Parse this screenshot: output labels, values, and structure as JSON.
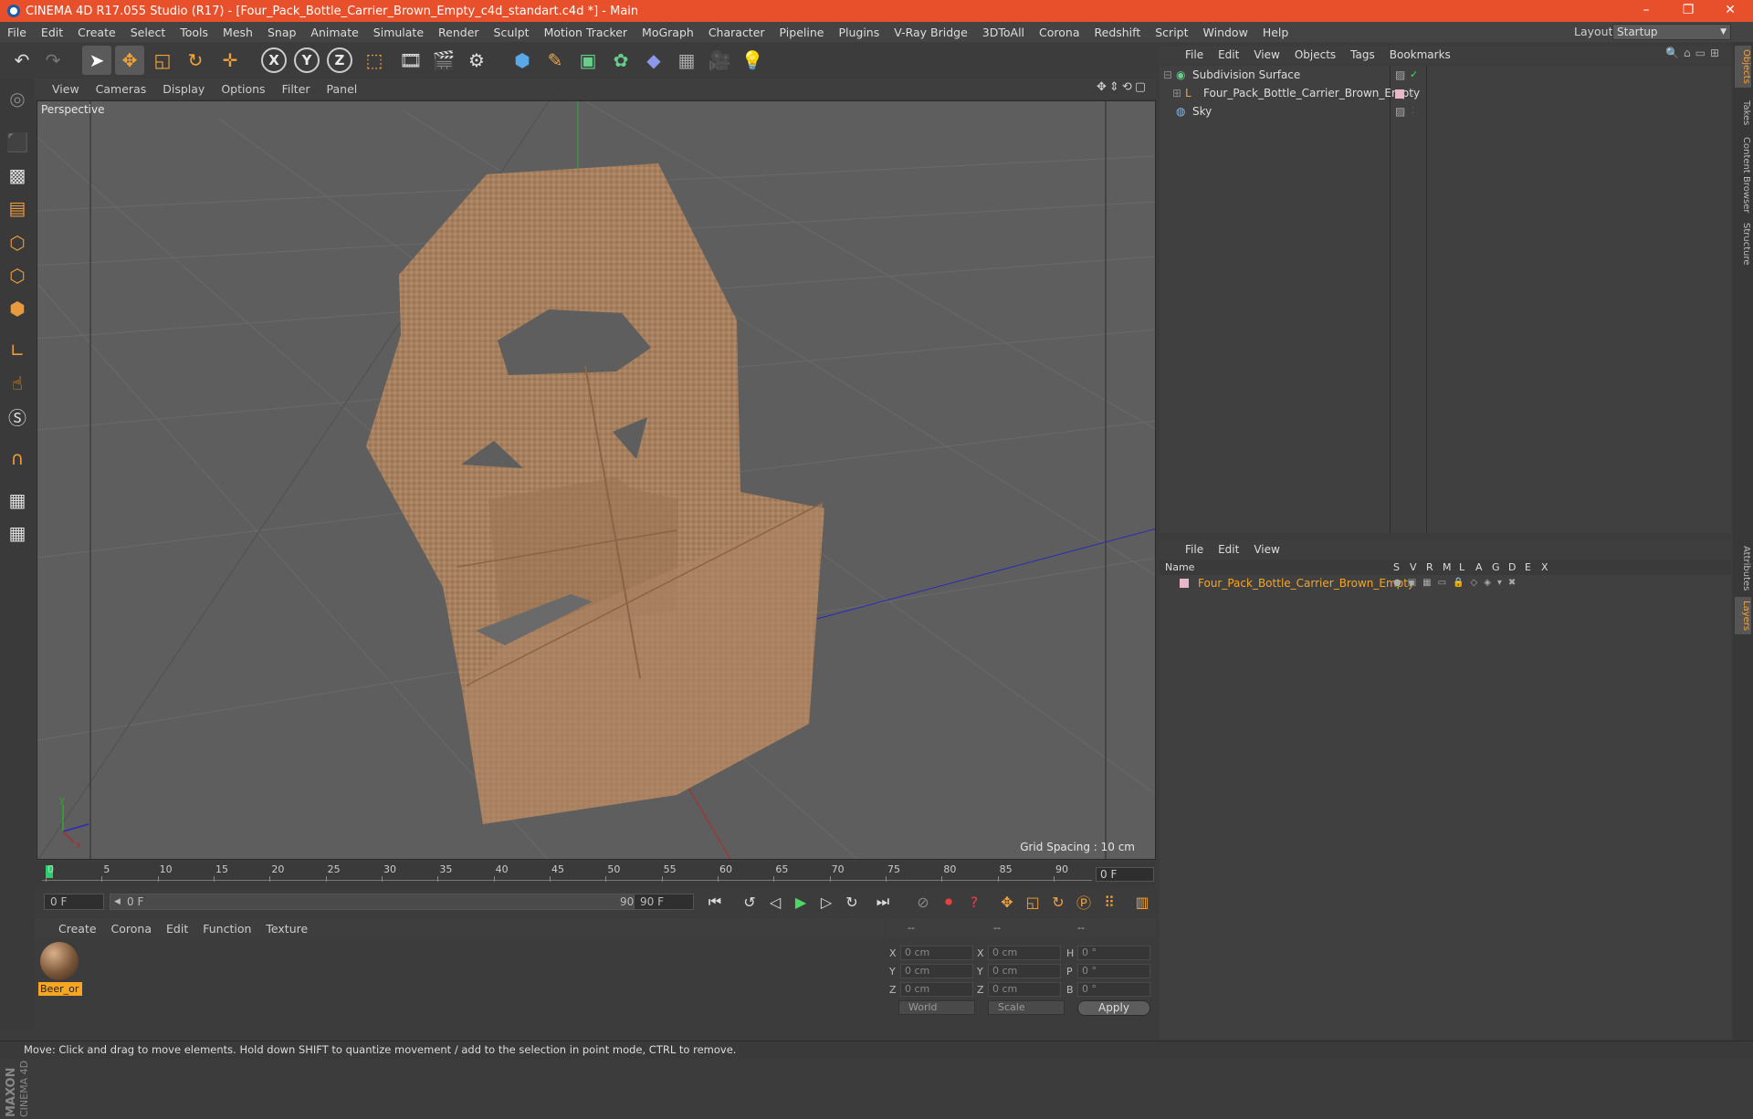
{
  "window": {
    "title": "CINEMA 4D R17.055 Studio (R17) - [Four_Pack_Bottle_Carrier_Brown_Empty_c4d_standart.c4d *] - Main",
    "minimize": "–",
    "maximize": "❐",
    "close": "✕"
  },
  "menubar": {
    "items": [
      "File",
      "Edit",
      "Create",
      "Select",
      "Tools",
      "Mesh",
      "Snap",
      "Animate",
      "Simulate",
      "Render",
      "Sculpt",
      "Motion Tracker",
      "MoGraph",
      "Character",
      "Pipeline",
      "Plugins",
      "V-Ray Bridge",
      "3DToAll",
      "Corona",
      "Redshift",
      "Script",
      "Window",
      "Help"
    ],
    "layout_label": "Layout:",
    "layout_value": "Startup"
  },
  "toolbar": {
    "axis_x": "X",
    "axis_y": "Y",
    "axis_z": "Z"
  },
  "viewport": {
    "menu": [
      "View",
      "Cameras",
      "Display",
      "Options",
      "Filter",
      "Panel"
    ],
    "camera_label": "Perspective",
    "grid_spacing": "Grid Spacing : 10 cm"
  },
  "timeline": {
    "ticks": [
      "0",
      "5",
      "10",
      "15",
      "20",
      "25",
      "30",
      "35",
      "40",
      "45",
      "50",
      "55",
      "60",
      "65",
      "70",
      "75",
      "80",
      "85",
      "90"
    ],
    "current_frame": "0 F",
    "start_field": "0 F",
    "range_start": "0 F",
    "range_end": "90 F",
    "end_field": "90 F"
  },
  "material_manager": {
    "menu": [
      "Create",
      "Corona",
      "Edit",
      "Function",
      "Texture"
    ],
    "material_name": "Beer_or"
  },
  "coordinates": {
    "header": [
      "--",
      "--",
      "--"
    ],
    "rows": [
      {
        "l1": "X",
        "v1": "0 cm",
        "l2": "X",
        "v2": "0 cm",
        "l3": "H",
        "v3": "0 °"
      },
      {
        "l1": "Y",
        "v1": "0 cm",
        "l2": "Y",
        "v2": "0 cm",
        "l3": "P",
        "v3": "0 °"
      },
      {
        "l1": "Z",
        "v1": "0 cm",
        "l2": "Z",
        "v2": "0 cm",
        "l3": "B",
        "v3": "0 °"
      }
    ],
    "space": "World",
    "mode": "Scale",
    "apply": "Apply"
  },
  "object_manager": {
    "menu": [
      "File",
      "Edit",
      "View",
      "Objects",
      "Tags",
      "Bookmarks"
    ],
    "objects": [
      {
        "name": "Subdivision Surface"
      },
      {
        "name": "Four_Pack_Bottle_Carrier_Brown_Empty"
      },
      {
        "name": "Sky"
      }
    ]
  },
  "layer_manager": {
    "menu": [
      "File",
      "Edit",
      "View"
    ],
    "columns": [
      "Name",
      "S",
      "V",
      "R",
      "M",
      "L",
      "A",
      "G",
      "D",
      "E",
      "X"
    ],
    "layers": [
      {
        "name": "Four_Pack_Bottle_Carrier_Brown_Empty"
      }
    ]
  },
  "right_tabs": [
    "Objects",
    "Takes",
    "Content Browser",
    "Structure",
    "Attributes",
    "Layers"
  ],
  "maxon_logo": "MAXON CINEMA 4D",
  "status": "Move: Click and drag to move elements. Hold down SHIFT to quantize movement / add to the selection in point mode, CTRL to remove.",
  "colors": {
    "title_bar": "#e8502c",
    "accent": "#f5a623",
    "viewport_bg": "#5e5e5e",
    "cardboard": "#a7805f"
  }
}
